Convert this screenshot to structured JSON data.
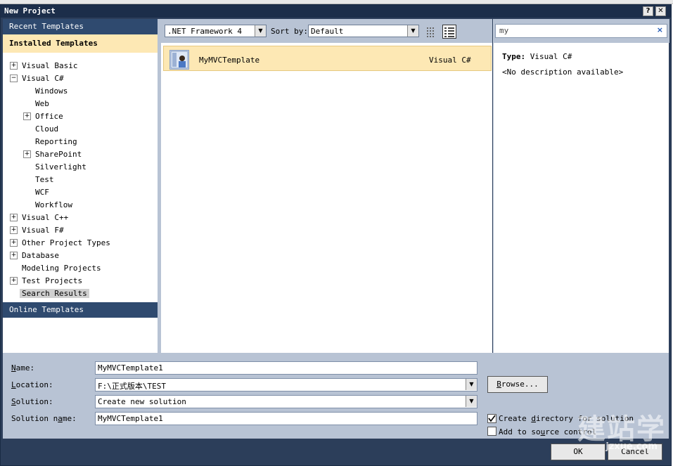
{
  "window": {
    "title": "New Project",
    "help_label": "?",
    "close_label": "✕"
  },
  "left": {
    "recent_label": "Recent Templates",
    "installed_label": "Installed Templates",
    "online_label": "Online Templates",
    "tree": [
      {
        "label": "Visual Basic",
        "expander": "+"
      },
      {
        "label": "Visual C#",
        "expander": "−"
      },
      {
        "label": "Windows",
        "expander": ""
      },
      {
        "label": "Web",
        "expander": ""
      },
      {
        "label": "Office",
        "expander": "+"
      },
      {
        "label": "Cloud",
        "expander": ""
      },
      {
        "label": "Reporting",
        "expander": ""
      },
      {
        "label": "SharePoint",
        "expander": "+"
      },
      {
        "label": "Silverlight",
        "expander": ""
      },
      {
        "label": "Test",
        "expander": ""
      },
      {
        "label": "WCF",
        "expander": ""
      },
      {
        "label": "Workflow",
        "expander": ""
      },
      {
        "label": "Visual C++",
        "expander": "+"
      },
      {
        "label": "Visual F#",
        "expander": "+"
      },
      {
        "label": "Other Project Types",
        "expander": "+"
      },
      {
        "label": "Database",
        "expander": "+"
      },
      {
        "label": "Modeling Projects",
        "expander": ""
      },
      {
        "label": "Test Projects",
        "expander": "+"
      },
      {
        "label": "Search Results",
        "expander": ""
      }
    ]
  },
  "toolbar": {
    "framework": ".NET Framework 4",
    "sort_label": "Sort by:",
    "sort_value": "Default"
  },
  "template_list": [
    {
      "name": "MyMVCTemplate",
      "language": "Visual C#"
    }
  ],
  "search": {
    "value": "my",
    "clear_icon": "×"
  },
  "details": {
    "type_label": "Type:",
    "type_value": "Visual C#",
    "description": "<No description available>"
  },
  "form": {
    "name_label": "Name:",
    "name_value": "MyMVCTemplate1",
    "location_label": "Location:",
    "location_value": "F:\\正式版本\\TEST",
    "solution_label": "Solution:",
    "solution_value": "Create new solution",
    "solution_name_label": "Solution name:",
    "solution_name_value": "MyMVCTemplate1",
    "browse_label": "Browse...",
    "create_dir_label": "Create directory for solution",
    "create_dir_checked": true,
    "source_control_label": "Add to source control",
    "source_control_checked": false
  },
  "footer": {
    "ok_label": "OK",
    "cancel_label": "Cancel"
  },
  "watermark": {
    "main": "建站学",
    "sub": "jzxue.com"
  },
  "colors": {
    "titlebar": "#1c2e4a",
    "panel": "#b8c3d4",
    "selected": "#fde8b4",
    "header": "#2f4a6f"
  }
}
